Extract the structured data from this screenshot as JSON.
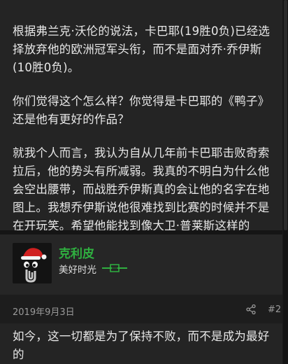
{
  "post": {
    "paragraphs": [
      "根据弗兰克·沃伦的说法，卡巴耶(19胜0负)已经选择放弃他的欧洲冠军头衔，而不是面对乔·乔伊斯(10胜0负)。",
      "你们觉得这个怎么样？你觉得是卡巴耶的《鸭子》还是他有更好的作品？",
      "就我个人而言，我认为自从几年前卡巴耶击败奇索拉后，他的势头有所减弱。我真的不明白为什么他会空出腰带，而战胜乔伊斯真的会让他的名字在地图上。我想乔伊斯说他很难找到比赛的时候并不是在开玩笑。希望他能找到像大卫·普莱斯这样的人。"
    ]
  },
  "reply": {
    "username": "克利皮",
    "user_title": "美好时光",
    "username_color": "#2fb040",
    "date": "2019年9月3日",
    "post_number": "#2",
    "text": "如今，这一切都是为了保持不败，而不是成为最好的"
  },
  "icons": {
    "avatar": "clippy-santa-avatar",
    "rank": "green-rank-badge-icon",
    "share": "share-icon"
  }
}
